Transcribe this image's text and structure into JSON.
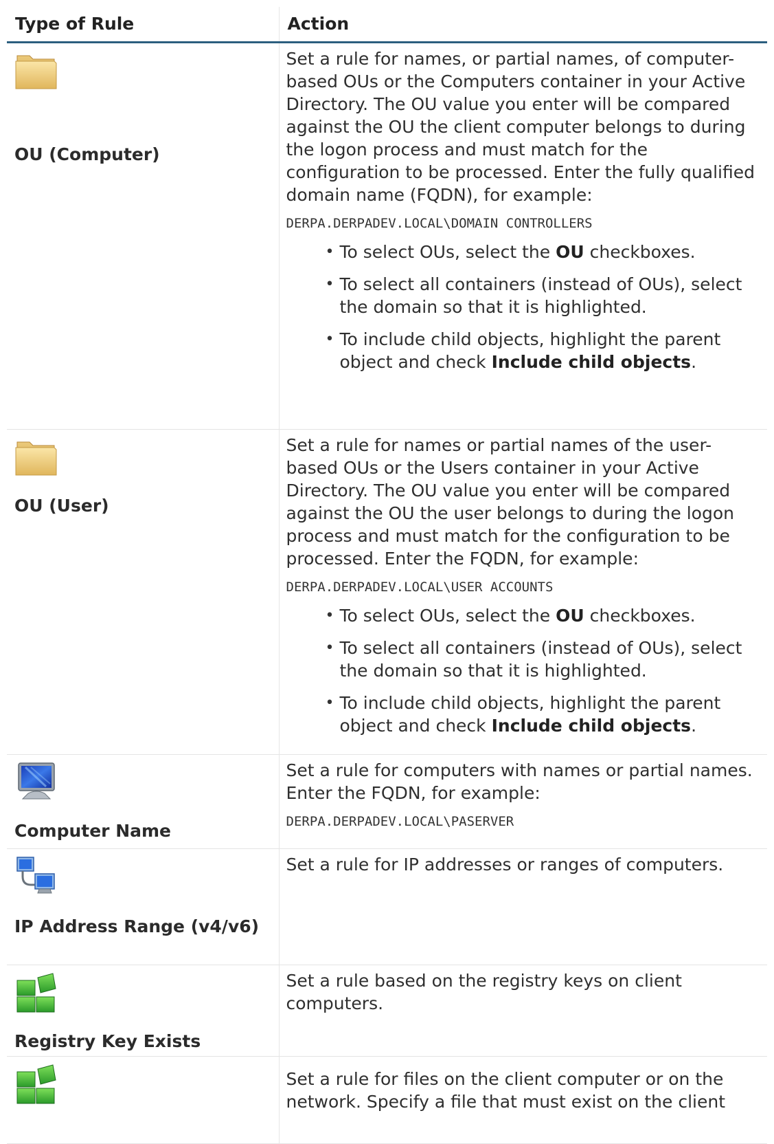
{
  "header": {
    "col_type": "Type of Rule",
    "col_action": "Action"
  },
  "rows": [
    {
      "label": "OU (Computer)",
      "icon": "folder-icon",
      "text": "Set a rule for names, or partial names, of computer-based OUs or the Computers container in your Active Directory. The OU value you enter will be compared against the OU the client computer belongs to during the logon process and must match for the configuration to be processed. Enter the fully qualified domain name (FQDN), for example:",
      "code": "DERPA.DERPADEV.LOCAL\\DOMAIN CONTROLLERS",
      "bullets": [
        {
          "pre": "To select OUs, select the ",
          "bold": "OU",
          "post": " checkboxes."
        },
        {
          "pre": "To select all containers (instead of OUs), select the domain so that it is highlighted.",
          "bold": "",
          "post": ""
        },
        {
          "pre": "To include child objects, highlight the parent object and check ",
          "bold": "Include child objects",
          "post": "."
        }
      ]
    },
    {
      "label": "OU (User)",
      "icon": "folder-icon",
      "text": "Set a rule for names or partial names of the user-based OUs or the Users container in your Active Directory. The OU value you enter will be compared against the OU the user belongs to during the logon process and must match for the configuration to be processed. Enter the FQDN, for example:",
      "code": "DERPA.DERPADEV.LOCAL\\USER ACCOUNTS",
      "bullets": [
        {
          "pre": "To select OUs, select the ",
          "bold": "OU",
          "post": " checkboxes."
        },
        {
          "pre": "To select all containers (instead of OUs), select the domain so that it is highlighted.",
          "bold": "",
          "post": ""
        },
        {
          "pre": "To include child objects, highlight the parent object and check ",
          "bold": "Include child objects",
          "post": "."
        }
      ]
    },
    {
      "label": "Computer Name",
      "icon": "monitor-icon",
      "text": "Set a rule for computers with names or partial names. Enter the FQDN, for example:",
      "code": "DERPA.DERPADEV.LOCAL\\PASERVER"
    },
    {
      "label": "IP Address Range (v4/v6)",
      "icon": "network-computers-icon",
      "text": "Set a rule for IP addresses or ranges of computers."
    },
    {
      "label": "Registry Key Exists",
      "icon": "registry-cubes-icon",
      "text": "Set a rule based on the registry keys on client computers."
    },
    {
      "label": "",
      "icon": "registry-cubes-icon",
      "text": "Set a rule for files on the client computer or on the network. Specify a file that must exist on the client"
    }
  ]
}
